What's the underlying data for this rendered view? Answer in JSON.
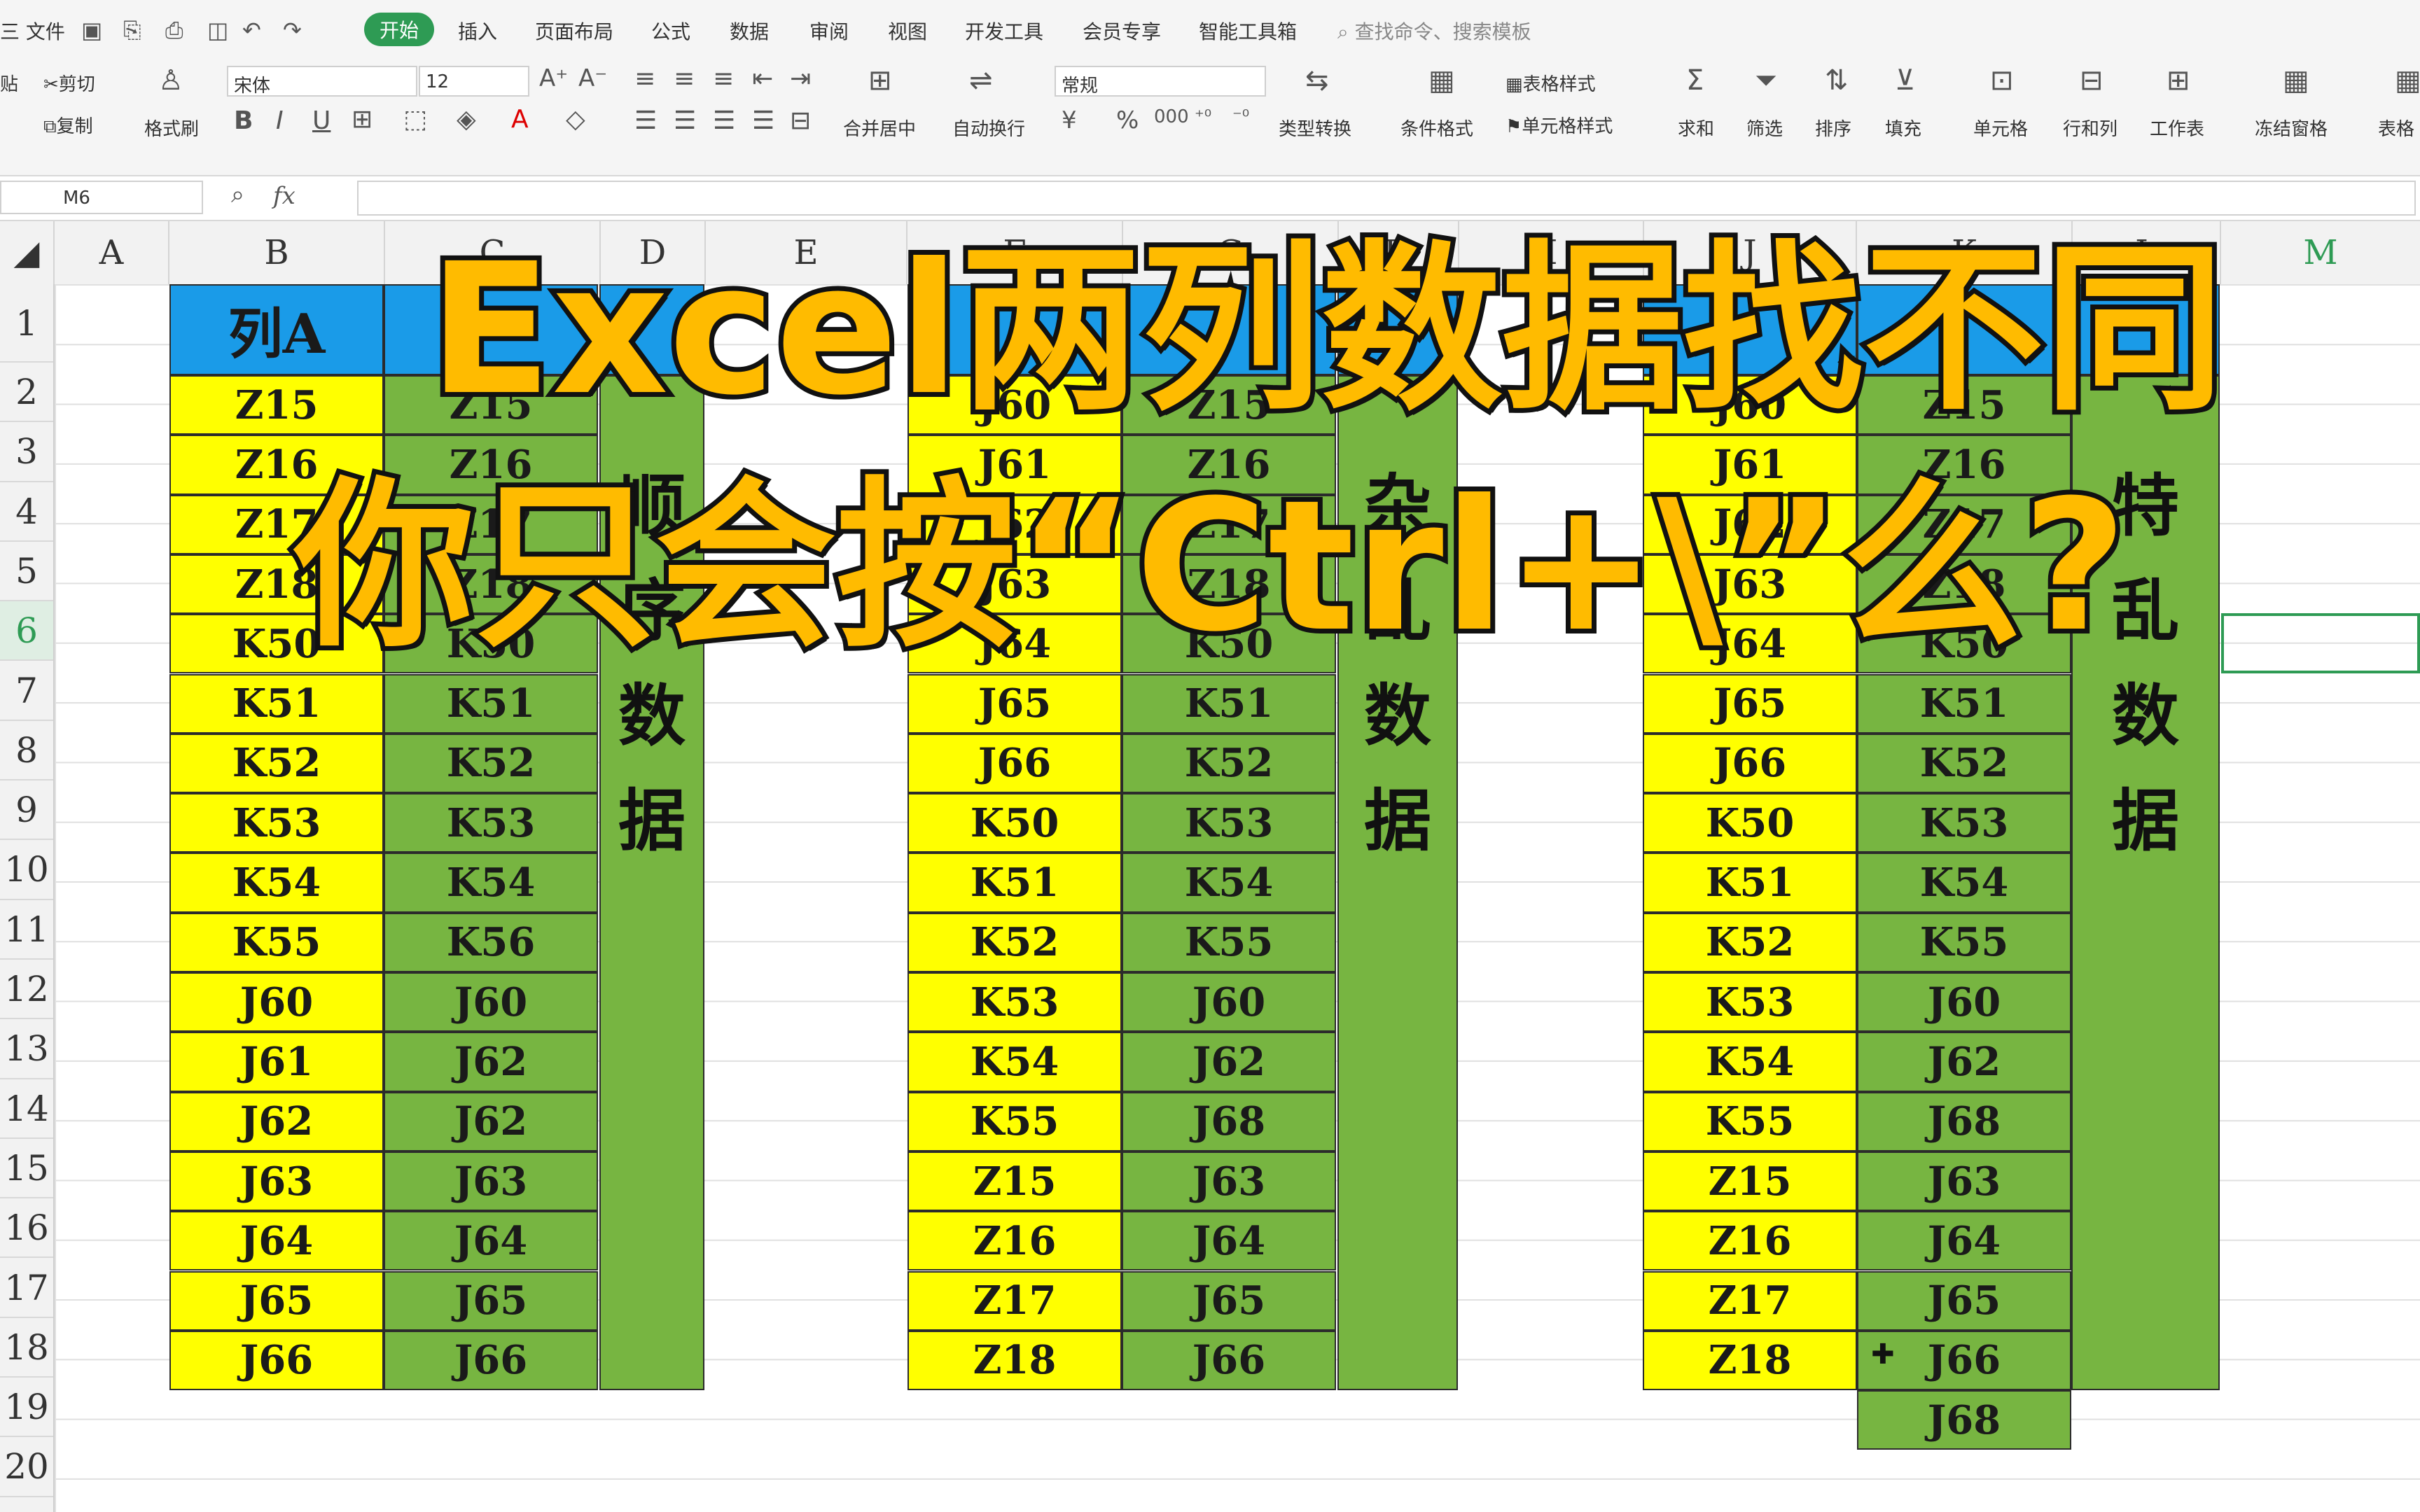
{
  "menu": {
    "file": "三 文件",
    "tabs": [
      "开始",
      "插入",
      "页面布局",
      "公式",
      "数据",
      "审阅",
      "视图",
      "开发工具",
      "会员专享",
      "智能工具箱"
    ],
    "active_tab": "开始",
    "search": "查找命令、搜索模板"
  },
  "toolbar": {
    "cut": "剪切",
    "copy": "复制",
    "format_painter": "格式刷",
    "paste_frag": "贴",
    "font_name": "宋体",
    "font_size": "12",
    "number_format": "常规",
    "merge_center": "合并居中",
    "wrap_text": "自动换行",
    "type_convert": "类型转换",
    "table_style": "表格样式",
    "cell_style": "单元格样式",
    "cond_format": "条件格式",
    "sum": "求和",
    "filter": "筛选",
    "sort": "排序",
    "fill": "填充",
    "cell": "单元格",
    "row_col": "行和列",
    "worksheet": "工作表",
    "freeze": "冻结窗格",
    "table_frag": "表格"
  },
  "formula_bar": {
    "name_box": "M6",
    "fx": "fx"
  },
  "columns": [
    "A",
    "B",
    "C",
    "D",
    "E",
    "F",
    "G",
    "H",
    "I",
    "J",
    "K",
    "L",
    "M"
  ],
  "rows": [
    "1",
    "2",
    "3",
    "4",
    "5",
    "6",
    "7",
    "8",
    "9",
    "10",
    "11",
    "12",
    "13",
    "14",
    "15",
    "16",
    "17",
    "18",
    "19",
    "20"
  ],
  "row_labels_visible": [
    "1",
    "2",
    "3",
    "4",
    "5",
    "6",
    "7",
    "8",
    "9",
    "10",
    "11",
    "12",
    "13",
    "14",
    "15",
    "16",
    "17",
    "18",
    "19",
    "20"
  ],
  "title": {
    "line1": "Excel两列数据找不同",
    "line2": "你只会按“Ctrl+\\”么?"
  },
  "sheet": {
    "header_a": "列A",
    "block1": {
      "label": "顺序数据",
      "col_a": [
        "Z15",
        "Z16",
        "Z17",
        "Z18",
        "K50",
        "K51",
        "K52",
        "K53",
        "K54",
        "K55",
        "J60",
        "J61",
        "J62",
        "J63",
        "J64",
        "J65",
        "J66"
      ],
      "col_b": [
        "Z15",
        "Z16",
        "Z17",
        "Z18",
        "K50",
        "K51",
        "K52",
        "K53",
        "K54",
        "K56",
        "J60",
        "J62",
        "J62",
        "J63",
        "J64",
        "J65",
        "J66"
      ]
    },
    "block2": {
      "label": "杂乱数据",
      "col_a": [
        "J60",
        "J61",
        "J62",
        "J63",
        "J64",
        "J65",
        "J66",
        "K50",
        "K51",
        "K52",
        "K53",
        "K54",
        "K55",
        "Z15",
        "Z16",
        "Z17",
        "Z18"
      ],
      "col_b": [
        "Z15",
        "Z16",
        "Z17",
        "Z18",
        "K50",
        "K51",
        "K52",
        "K53",
        "K54",
        "K55",
        "J60",
        "J62",
        "J68",
        "J63",
        "J64",
        "J65",
        "J66"
      ]
    },
    "block3": {
      "label": "特乱数据",
      "col_a": [
        "J60",
        "J61",
        "J62",
        "J63",
        "J64",
        "J65",
        "J66",
        "K50",
        "K51",
        "K52",
        "K53",
        "K54",
        "K55",
        "Z15",
        "Z16",
        "Z17",
        "Z18"
      ],
      "col_b": [
        "Z15",
        "Z16",
        "Z17",
        "Z18",
        "K50",
        "K51",
        "K52",
        "K53",
        "K54",
        "K55",
        "J60",
        "J62",
        "J68",
        "J63",
        "J64",
        "J65",
        "J66",
        "J68"
      ]
    }
  }
}
